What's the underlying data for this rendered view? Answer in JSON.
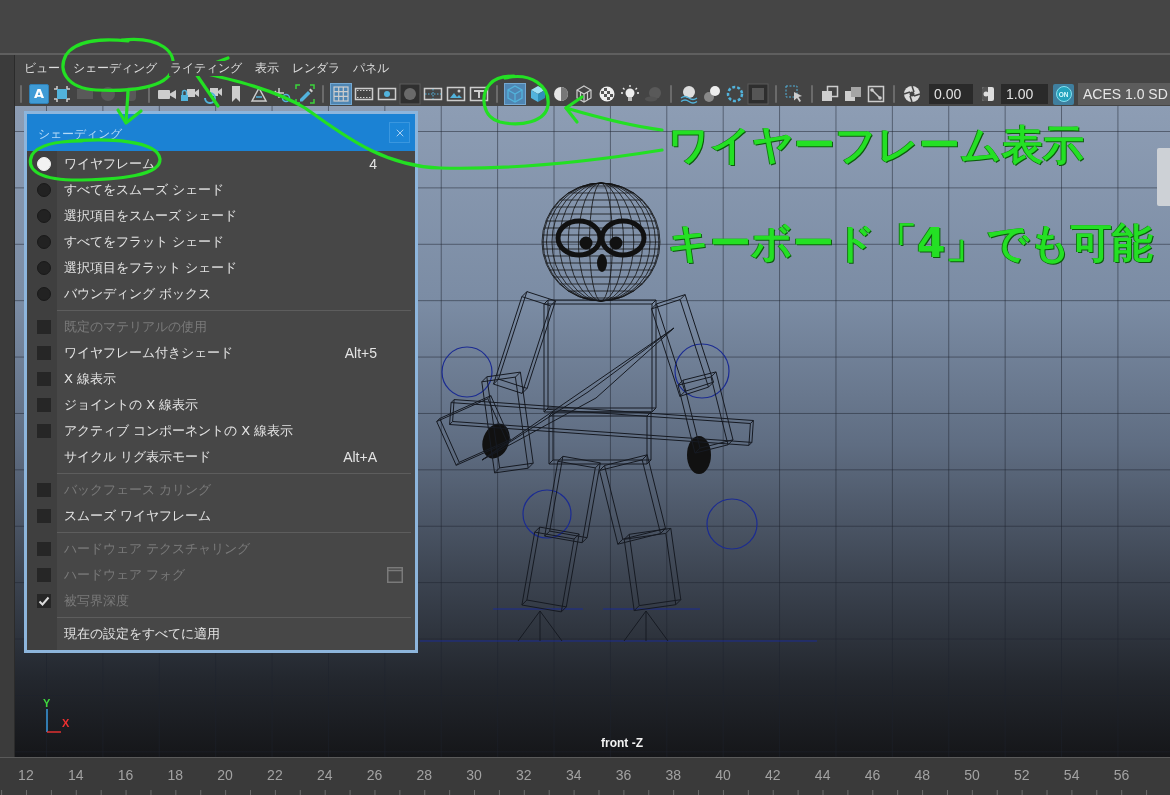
{
  "menu_bar": [
    {
      "label": "ビュー"
    },
    {
      "label": "シェーディング"
    },
    {
      "label": "ライティング"
    },
    {
      "label": "表示"
    },
    {
      "label": "レンダラ"
    },
    {
      "label": "パネル"
    }
  ],
  "toolbar": {
    "groups": [
      {
        "buttons": [
          {
            "label": "A",
            "on": false,
            "disabled": false
          },
          {
            "on": false,
            "disabled": false
          },
          {
            "on": false,
            "disabled": true
          },
          {
            "on": false,
            "disabled": true
          },
          {
            "on": false,
            "disabled": true
          }
        ]
      },
      {
        "buttons": [
          {
            "on": false,
            "disabled": false
          },
          {
            "on": false,
            "disabled": false
          },
          {
            "on": false,
            "disabled": false
          },
          {
            "on": false,
            "disabled": false
          },
          {
            "on": false,
            "disabled": false
          },
          {
            "on": false,
            "disabled": false
          },
          {
            "on": false,
            "disabled": false
          }
        ]
      },
      {
        "buttons": [
          {
            "on": true,
            "disabled": false
          },
          {
            "on": false,
            "disabled": false
          },
          {
            "on": false,
            "disabled": false
          },
          {
            "on": false,
            "disabled": false
          },
          {
            "on": false,
            "disabled": false
          },
          {
            "on": false,
            "disabled": false
          },
          {
            "on": false,
            "disabled": false
          }
        ]
      },
      {
        "buttons": [
          {
            "on": true,
            "disabled": false
          },
          {
            "on": false,
            "disabled": false
          },
          {
            "on": false,
            "disabled": false
          },
          {
            "on": false,
            "disabled": false
          },
          {
            "on": false,
            "disabled": false
          },
          {
            "on": false,
            "disabled": false
          },
          {
            "on": false,
            "disabled": true
          }
        ]
      },
      {
        "buttons": [
          {
            "on": false,
            "disabled": false
          },
          {
            "on": false,
            "disabled": false
          },
          {
            "on": false,
            "disabled": false
          },
          {
            "on": false,
            "disabled": false
          }
        ]
      },
      {
        "buttons": [
          {
            "on": false,
            "disabled": false
          }
        ]
      },
      {
        "buttons": [
          {
            "on": false,
            "disabled": false
          },
          {
            "on": false,
            "disabled": false
          },
          {
            "on": false,
            "disabled": false
          }
        ]
      }
    ],
    "exposure": "0.00",
    "gamma": "1.00",
    "view_transform_toggle": {
      "label": "ON",
      "on": true
    },
    "view_transform": "ACES 1.0 SD"
  },
  "viewport": {
    "camera": "front -Z",
    "axis_labels": [
      "Y",
      "X"
    ]
  },
  "shading_menu": {
    "title": "シェーディング",
    "sections": [
      {
        "items": [
          {
            "kind": "radio",
            "label": "ワイヤフレーム",
            "shortcut": "4",
            "selected": true,
            "disabled": false
          },
          {
            "kind": "radio",
            "label": "すべてをスムーズ シェード",
            "selected": false,
            "disabled": false
          },
          {
            "kind": "radio",
            "label": "選択項目をスムーズ シェード",
            "selected": false,
            "disabled": false
          },
          {
            "kind": "radio",
            "label": "すべてをフラット シェード",
            "selected": false,
            "disabled": false
          },
          {
            "kind": "radio",
            "label": "選択項目をフラット シェード",
            "selected": false,
            "disabled": false
          },
          {
            "kind": "radio",
            "label": "バウンディング ボックス",
            "selected": false,
            "disabled": false
          }
        ]
      },
      {
        "items": [
          {
            "kind": "check",
            "label": "既定のマテリアルの使用",
            "checked": false,
            "disabled": true
          },
          {
            "kind": "check",
            "label": "ワイヤフレーム付きシェード",
            "shortcut": "Alt+5",
            "checked": false,
            "disabled": false
          },
          {
            "kind": "check",
            "label": "X 線表示",
            "checked": false,
            "disabled": false
          },
          {
            "kind": "check",
            "label": "ジョイントの X 線表示",
            "checked": false,
            "disabled": false
          },
          {
            "kind": "check",
            "label": "アクティブ コンポーネントの X 線表示",
            "checked": false,
            "disabled": false
          },
          {
            "kind": "command",
            "label": "サイクル リグ表示モード",
            "shortcut": "Alt+A",
            "disabled": false
          }
        ]
      },
      {
        "items": [
          {
            "kind": "check",
            "label": "バックフェース カリング",
            "checked": false,
            "disabled": true
          },
          {
            "kind": "check",
            "label": "スムーズ ワイヤフレーム",
            "checked": false,
            "disabled": false
          }
        ]
      },
      {
        "items": [
          {
            "kind": "check",
            "label": "ハードウェア テクスチャリング",
            "checked": false,
            "disabled": true
          },
          {
            "kind": "check",
            "label": "ハードウェア フォグ",
            "checked": false,
            "disabled": true,
            "option_box": true
          },
          {
            "kind": "check",
            "label": "被写界深度",
            "checked": true,
            "disabled": true
          }
        ]
      },
      {
        "items": [
          {
            "kind": "command",
            "label": "現在の設定をすべてに適用",
            "disabled": false
          }
        ]
      }
    ]
  },
  "annotations": [
    {
      "text": "ワイヤーフレーム表示"
    },
    {
      "text": "キーボード「4」でも可能"
    }
  ],
  "time_ruler": {
    "ticks": [
      "12",
      "14",
      "16",
      "18",
      "20",
      "22",
      "24",
      "26",
      "28",
      "30",
      "32",
      "34",
      "36",
      "38",
      "40",
      "42",
      "44",
      "46",
      "48",
      "50",
      "52",
      "54",
      "56"
    ]
  }
}
